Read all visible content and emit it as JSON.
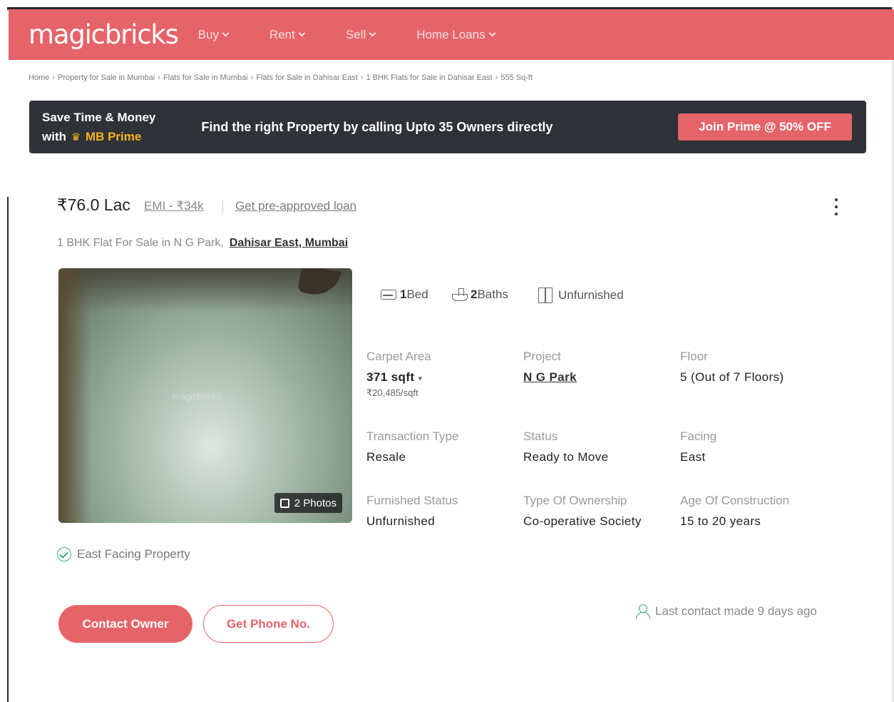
{
  "header": {
    "logo": "magicbricks",
    "nav": [
      {
        "label": "Buy"
      },
      {
        "label": "Rent"
      },
      {
        "label": "Sell"
      },
      {
        "label": "Home Loans"
      }
    ]
  },
  "breadcrumb": [
    "Home",
    "Property for Sale in Mumbai",
    "Flats for Sale in Mumbai",
    "Flats for Sale in Dahisar East",
    "1 BHK Flats for Sale in Dahisar East",
    "555 Sq-ft"
  ],
  "prime_banner": {
    "line1": "Save Time & Money",
    "line2_prefix": "with",
    "brand": "MB Prime",
    "message": "Find the right Property by calling Upto 35 Owners directly",
    "cta": "Join Prime @ 50% OFF"
  },
  "listing": {
    "price": "₹76.0 Lac",
    "emi": "EMI - ₹34k",
    "preapproved": "Get pre-approved loan",
    "title": "1 BHK Flat For Sale in N G Park,",
    "location": "Dahisar East, Mumbai",
    "photo_watermark": "magicbricks",
    "photo_count": "2 Photos",
    "amenities": {
      "bed_num": "1",
      "bed_label": "Bed",
      "bath_num": "2",
      "bath_label": "Baths",
      "furnishing": "Unfurnished"
    },
    "details": {
      "carpet_area_label": "Carpet Area",
      "carpet_area_value": "371 sqft",
      "carpet_area_rate": "₹20,485/sqft",
      "project_label": "Project",
      "project_value": "N G Park",
      "floor_label": "Floor",
      "floor_value": "5 (Out of 7 Floors)",
      "transaction_label": "Transaction Type",
      "transaction_value": "Resale",
      "status_label": "Status",
      "status_value": "Ready to Move",
      "facing_label": "Facing",
      "facing_value": "East",
      "furnished_label": "Furnished Status",
      "furnished_value": "Unfurnished",
      "ownership_label": "Type Of Ownership",
      "ownership_value": "Co-operative Society",
      "age_label": "Age Of Construction",
      "age_value": "15 to 20 years"
    },
    "highlight": "East Facing Property",
    "contact_owner": "Contact Owner",
    "get_phone": "Get Phone No.",
    "last_contact": "Last contact made 9 days ago"
  },
  "colors": {
    "brand": "#e5646a",
    "banner_bg": "#2f3236",
    "prime_gold": "#f5b51c",
    "success": "#3bb07b"
  }
}
